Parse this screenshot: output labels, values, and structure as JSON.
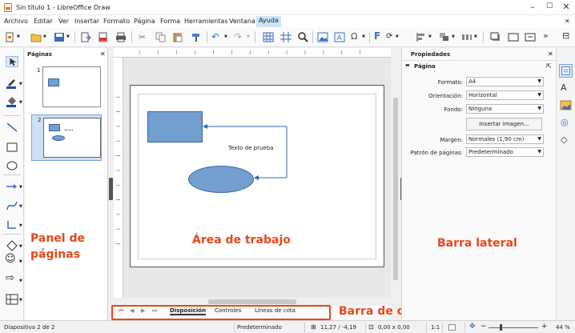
{
  "window": {
    "title": "Sin título 1 - LibreOffice Draw"
  },
  "menu": [
    "Archivo",
    "Editar",
    "Ver",
    "Insertar",
    "Formato",
    "Página",
    "Forma",
    "Herramientas",
    "Ventana",
    "Ayuda"
  ],
  "pages_panel": {
    "title": "Páginas",
    "slides": [
      "1",
      "2"
    ]
  },
  "canvas": {
    "text_label": "Texto de prueba"
  },
  "sidebar": {
    "title": "Propiedades",
    "section": "Página",
    "format_label": "Formato:",
    "format_value": "A4",
    "orientation_label": "Orientación:",
    "orientation_value": "Horizontal",
    "background_label": "Fondo:",
    "background_value": "Ninguna",
    "insert_image": "Insertar imagen...",
    "margin_label": "Margen:",
    "margin_value": "Normales (1,90 cm)",
    "master_label": "Patrón de páginas:",
    "master_value": "Predeterminado"
  },
  "layers": {
    "tabs": [
      "Disposición",
      "Controles",
      "Líneas de cota"
    ]
  },
  "status": {
    "slide": "Diapositiva 2 de 2",
    "master": "Predeterminado",
    "position": "11,27 / -4,19",
    "size": "0,00 x 0,00",
    "scale": "1:1",
    "zoom": "44 %"
  },
  "annotations": {
    "pages_panel": "Panel de\npáginas",
    "workarea": "Área de trabajo",
    "sidebar": "Barra lateral",
    "layerbar": "Barra de capas"
  },
  "colors": {
    "shape_fill": "#729fcf",
    "shape_stroke": "#3465a4",
    "annotation": "#e8471c",
    "menu_active": "#cce4f7"
  }
}
